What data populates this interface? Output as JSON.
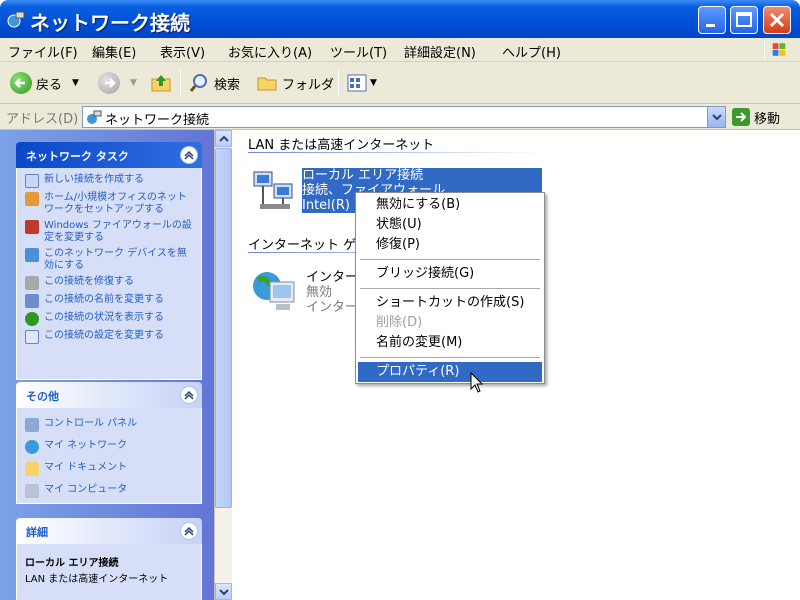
{
  "window": {
    "title": "ネットワーク接続"
  },
  "menubar": {
    "items": [
      "ファイル(F)",
      "編集(E)",
      "表示(V)",
      "お気に入り(A)",
      "ツール(T)",
      "詳細設定(N)",
      "ヘルプ(H)"
    ]
  },
  "toolbar": {
    "back_label": "戻る",
    "search_label": "検索",
    "folders_label": "フォルダ"
  },
  "address": {
    "label": "アドレス(D)",
    "value": "ネットワーク接続",
    "go_label": "移動"
  },
  "taskpane": {
    "network_tasks": {
      "title": "ネットワーク タスク",
      "items": [
        "新しい接続を作成する",
        "ホーム/小規模オフィスのネットワークをセットアップする",
        "Windows ファイアウォールの設定を変更する",
        "このネットワーク デバイスを無効にする",
        "この接続を修復する",
        "この接続の名前を変更する",
        "この接続の状況を表示する",
        "この接続の設定を変更する"
      ]
    },
    "other_places": {
      "title": "その他",
      "items": [
        "コントロール パネル",
        "マイ ネットワーク",
        "マイ ドキュメント",
        "マイ コンピュータ"
      ]
    },
    "details": {
      "title": "詳細",
      "lines": [
        "ローカル エリア接続",
        "LAN または高速インターネット"
      ]
    }
  },
  "content": {
    "group_lan": "LAN または高速インターネット",
    "group_internet": "インターネット ゲ",
    "lan_conn": {
      "line1": "ローカル エリア接続",
      "line2": "接続、ファイアウォール",
      "line3": "Intel(R)"
    },
    "inet_conn": {
      "line1": "インターネ",
      "line2": "無効",
      "line3": "インター"
    }
  },
  "context_menu": {
    "items": [
      {
        "label": "無効にする(B)"
      },
      {
        "label": "状態(U)"
      },
      {
        "label": "修復(P)"
      },
      {
        "label": "ブリッジ接続(G)"
      },
      {
        "label": "ショートカットの作成(S)"
      },
      {
        "label": "削除(D)",
        "disabled": true
      },
      {
        "label": "名前の変更(M)"
      },
      {
        "label": "プロパティ(R)",
        "highlighted": true
      }
    ]
  },
  "colors": {
    "titlebar": "#0054e3",
    "selection": "#316ac5",
    "link": "#215dc6"
  }
}
